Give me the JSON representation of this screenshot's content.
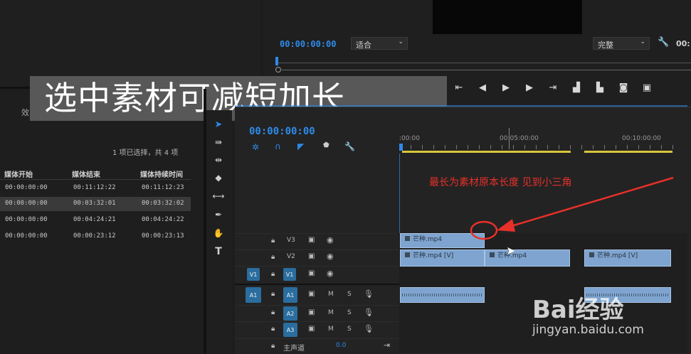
{
  "caption": "选中素材可减短加长",
  "program_monitor": {
    "timecode_left": "00:00:00:00",
    "fit_label": "适合",
    "quality_label": "完整",
    "timecode_right": "00:"
  },
  "project_panel": {
    "tab_partial": "效",
    "selection_info": "1 项已选择，共 4 项",
    "columns": [
      "媒体开始",
      "媒体结束",
      "媒体持续时间"
    ],
    "rows": [
      [
        "00:00:00:00",
        "00:11:12:22",
        "00:11:12:23"
      ],
      [
        "00:00:00:00",
        "00:03:32:01",
        "00:03:32:02"
      ],
      [
        "00:00:00:00",
        "00:04:24:21",
        "00:04:24:22"
      ],
      [
        "00:00:00:00",
        "00:00:23:12",
        "00:00:23:13"
      ]
    ]
  },
  "timeline": {
    "timecode": "00:00:00:00",
    "ruler_labels": [
      ":00:00",
      "00:05:00:00",
      "00:10:00:00"
    ],
    "tracks": {
      "v3": "V3",
      "v2": "V2",
      "v1": "V1",
      "v1_src": "V1",
      "a1": "A1",
      "a1_src": "A1",
      "a2": "A2",
      "a3": "A3",
      "mute": "M",
      "solo": "S"
    },
    "master_label": "主声道",
    "master_value": "0.0",
    "clips": {
      "v3_clip": "芒种.mp4",
      "v2_clip_1": "芒种.mp4 [V]",
      "v2_clip_2": "芒种.mp4",
      "v2_clip_3": "芒种.mp4 [V]"
    }
  },
  "annotation": {
    "text": "最长为素材原本长度 见到小三角",
    "color": "#e8302a"
  },
  "watermark": {
    "brand": "Bai经验",
    "url": "jingyan.baidu.com"
  }
}
